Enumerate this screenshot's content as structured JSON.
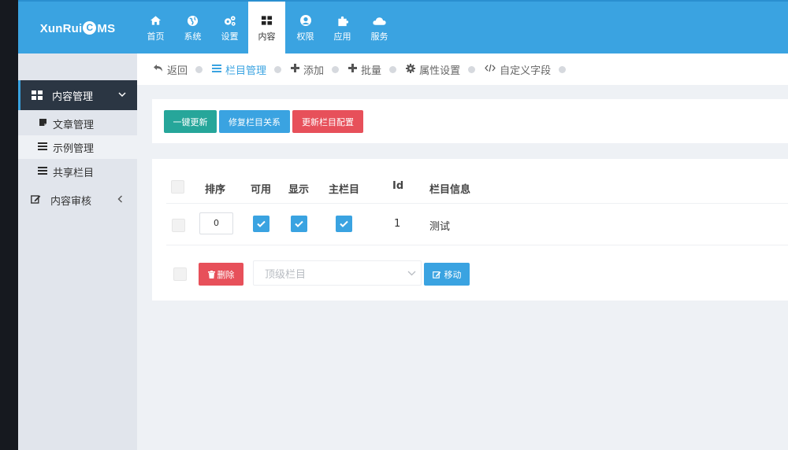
{
  "brand": {
    "pre": "XunRui",
    "c": "C",
    "post": "MS"
  },
  "topnav": [
    {
      "label": "首页",
      "icon": "home-icon"
    },
    {
      "label": "系统",
      "icon": "globe-icon"
    },
    {
      "label": "设置",
      "icon": "gears-icon"
    },
    {
      "label": "内容",
      "icon": "grid-icon",
      "active": true
    },
    {
      "label": "权限",
      "icon": "user-circle-icon"
    },
    {
      "label": "应用",
      "icon": "puzzle-icon"
    },
    {
      "label": "服务",
      "icon": "cloud-icon"
    }
  ],
  "sidebar": {
    "group": "内容管理",
    "items": [
      {
        "label": "文章管理",
        "icon": "note-icon"
      },
      {
        "label": "示例管理",
        "icon": "list-icon"
      },
      {
        "label": "共享栏目",
        "icon": "list-icon"
      }
    ],
    "review": "内容审核"
  },
  "breadcrumb": [
    {
      "label": "返回",
      "icon": "reply-icon"
    },
    {
      "label": "栏目管理",
      "icon": "list-icon",
      "active": true
    },
    {
      "label": "添加",
      "icon": "plus-icon"
    },
    {
      "label": "批量",
      "icon": "plus-icon"
    },
    {
      "label": "属性设置",
      "icon": "cog-icon"
    },
    {
      "label": "自定义字段",
      "icon": "code-icon"
    }
  ],
  "actions": {
    "update_all": "一键更新",
    "repair_relations": "修复栏目关系",
    "update_config": "更新栏目配置"
  },
  "table": {
    "headers": {
      "order": "排序",
      "enabled": "可用",
      "display": "显示",
      "main": "主栏目",
      "id": "Id",
      "info": "栏目信息"
    },
    "rows": [
      {
        "order": "0",
        "enabled": true,
        "display": true,
        "main": true,
        "id": "1",
        "info": "测试"
      }
    ]
  },
  "footer": {
    "delete": "删除",
    "select_placeholder": "顶级栏目",
    "move": "移动"
  }
}
